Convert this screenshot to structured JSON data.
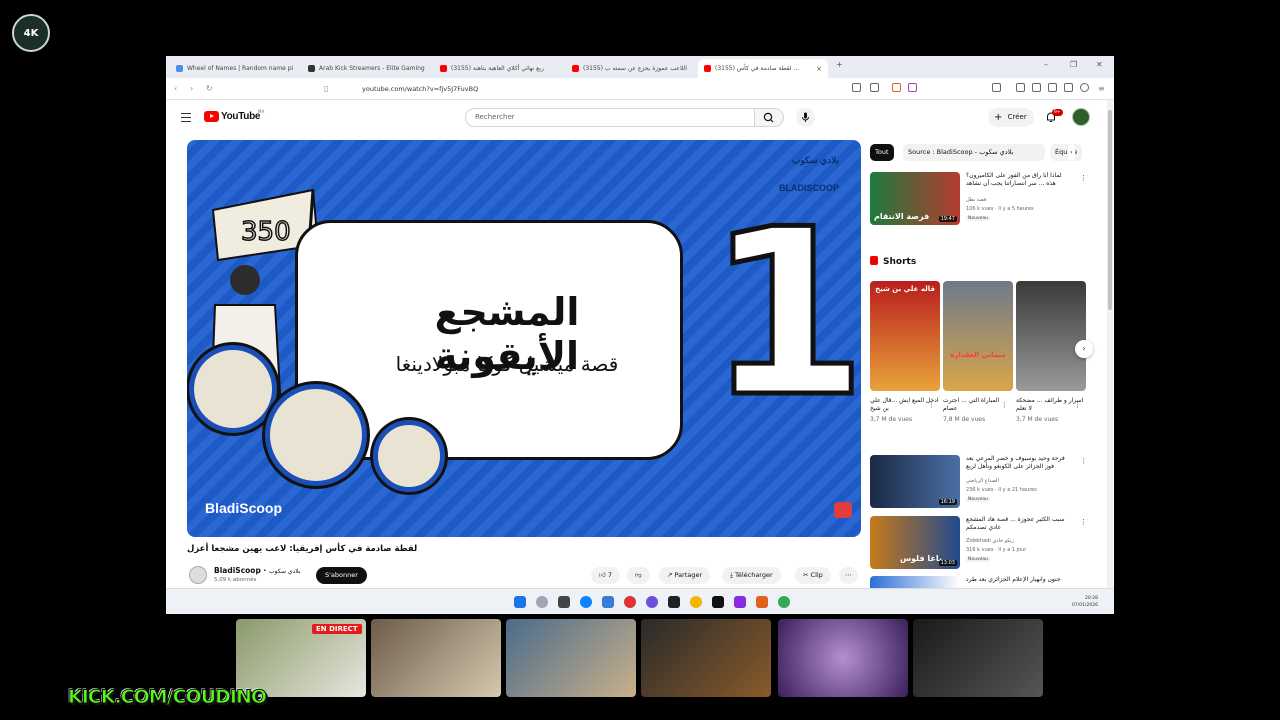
{
  "stream": {
    "logo_text": "4K",
    "live_badge": "EN DIRECT",
    "kick_url": "KICK.COM/COUDINO"
  },
  "browser": {
    "tabs": [
      {
        "label": "Wheel of Names | Random name pi",
        "color": "#4a90e2"
      },
      {
        "label": "Arab Kick Streamers - Elite Gaming",
        "color": "#333333"
      },
      {
        "label": "(3155) ربع نهائي أكلاي العاهبة بتاهنة",
        "color": "#ff0000"
      },
      {
        "label": "(3155) اللاعب عموزة يحزع عن سمته ب",
        "color": "#ff0000"
      },
      {
        "label": "(3155) لقطة صادمة في كأس ...",
        "color": "#ff0000"
      }
    ],
    "url": "youtube.com/watch?v=fjv5J7FuvBQ"
  },
  "youtube": {
    "brand": "YouTube",
    "country": "MA",
    "search_placeholder": "Rechercher",
    "create_label": "Créer",
    "notif_count": "9+"
  },
  "video": {
    "big_number": "1",
    "headline": "المشجع الأيقونة",
    "subheadline": "قصة ميشيل كوكا مبولادينغا",
    "brand": "BladiScoop",
    "watermark": "بلادي سكوب BLADISCOOP",
    "title": "لقطة صادمة في كأس إفريقيا: لاعب يهين مشجعا أعزل",
    "channel_name": "BladiScoop",
    "channel_arabic": "بلادي سكوب",
    "subs": "5,09 k abonnés",
    "subscribe": "S'abonner",
    "likes": "7",
    "share": "Partager",
    "download": "Télécharger",
    "clip": "Clip",
    "more": "⋯"
  },
  "sidebar": {
    "chips": [
      "Tout",
      "Source : BladiScoop - بلادي سكوب",
      "Équipe"
    ],
    "recs": [
      {
        "title": "لماذا أنا راق من الفوز على الكاميرون؟ هذه ... سر انتصاراتنا يجب أن نشاهد المقطع قبل",
        "channel": "قصة بطل",
        "meta": "106 k vues · Il y a 5 heures",
        "duration": "19:47",
        "badge": "Nouveau",
        "thumb_text": "فرصة الانتقام"
      },
      {
        "title": "فرحة وحيد بوسيوف و خضر المرعي بعد فوز الجزائر على الكونغو وتأهل لربع النهائي",
        "channel": "الصداع الرياضي",
        "meta": "236 k vues · Il y a 21 heures",
        "duration": "16:19",
        "badge": "Nouveau",
        "thumb_text": ""
      },
      {
        "title": "سبب الكثير عجوزة ... قصة هاد المشجع غادي تصدمكم",
        "channel": "Zidekhadi زيكو خادي",
        "meta": "316 k vues · Il y a 1 jour",
        "duration": "13:03",
        "badge": "Nouveau",
        "thumb_text": "باغا فلوس"
      },
      {
        "title": "جنون وانهيار الإعلام الجزائري بعد طرد",
        "channel": "",
        "meta": "",
        "duration": "",
        "badge": "",
        "thumb_text": ""
      }
    ],
    "shorts_title": "Shorts",
    "shorts": [
      {
        "title": "ادخل المبع ايش ...قال علي بن شيخ",
        "views": "3,7 M de vues",
        "thumb_text": "قاله علي بن شيخ"
      },
      {
        "title": "المباراة التي ... اجترت عصام",
        "views": "7,8 M de vues",
        "thumb_text": "ميماني العقدارة"
      },
      {
        "title": "اسرار و طرائف ... مضحكة لا تعلم",
        "views": "3,7 M de vues",
        "thumb_text": ""
      }
    ]
  },
  "taskbar": {
    "time": "20:28",
    "date": "07/01/2026"
  },
  "colors": {
    "yt_red": "#ff0000",
    "player_blue": "#1f5fd0",
    "kick_green": "#53fc18"
  }
}
